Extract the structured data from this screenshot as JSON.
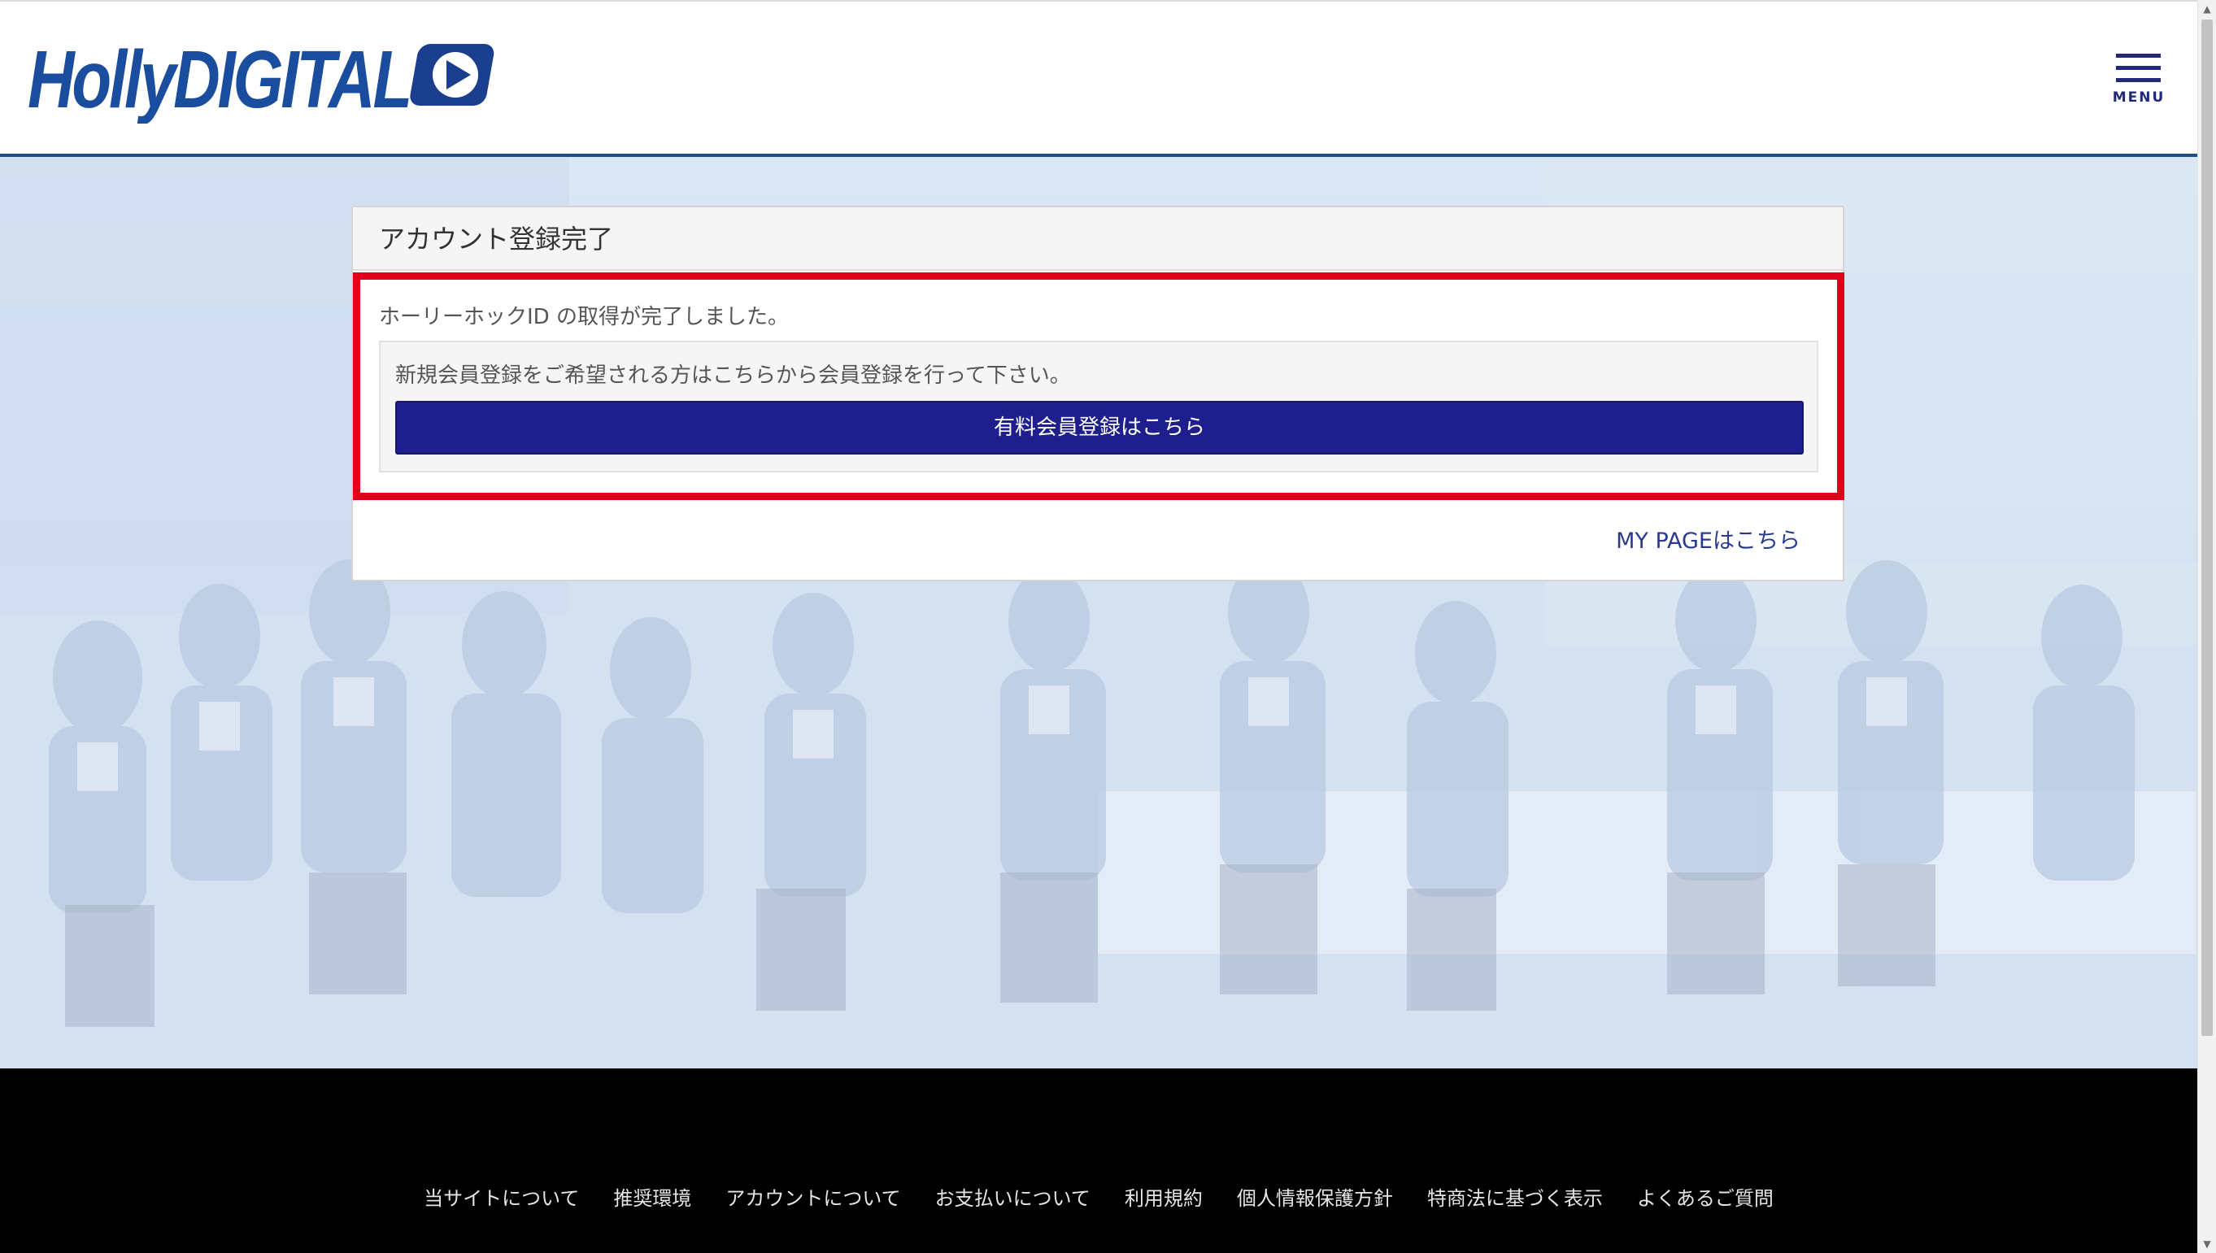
{
  "header": {
    "logo_text": "HollyDIGITAL",
    "menu_label": "MENU"
  },
  "card": {
    "title": "アカウント登録完了",
    "done_message": "ホーリーホックID の取得が完了しました。",
    "register_prompt": "新規会員登録をご希望される方はこちらから会員登録を行って下さい。",
    "register_button": "有料会員登録はこちら",
    "mypage_link": "MY PAGEはこちら"
  },
  "footer": {
    "links": [
      "当サイトについて",
      "推奨環境",
      "アカウントについて",
      "お支払いについて",
      "利用規約",
      "個人情報保護方針",
      "特商法に基づく表示",
      "よくあるご質問"
    ]
  },
  "colors": {
    "brand_navy": "#23297a",
    "button_blue": "#1e1f8c",
    "highlight_red": "#e0001b",
    "logo_blue": "#1a4d9e"
  }
}
